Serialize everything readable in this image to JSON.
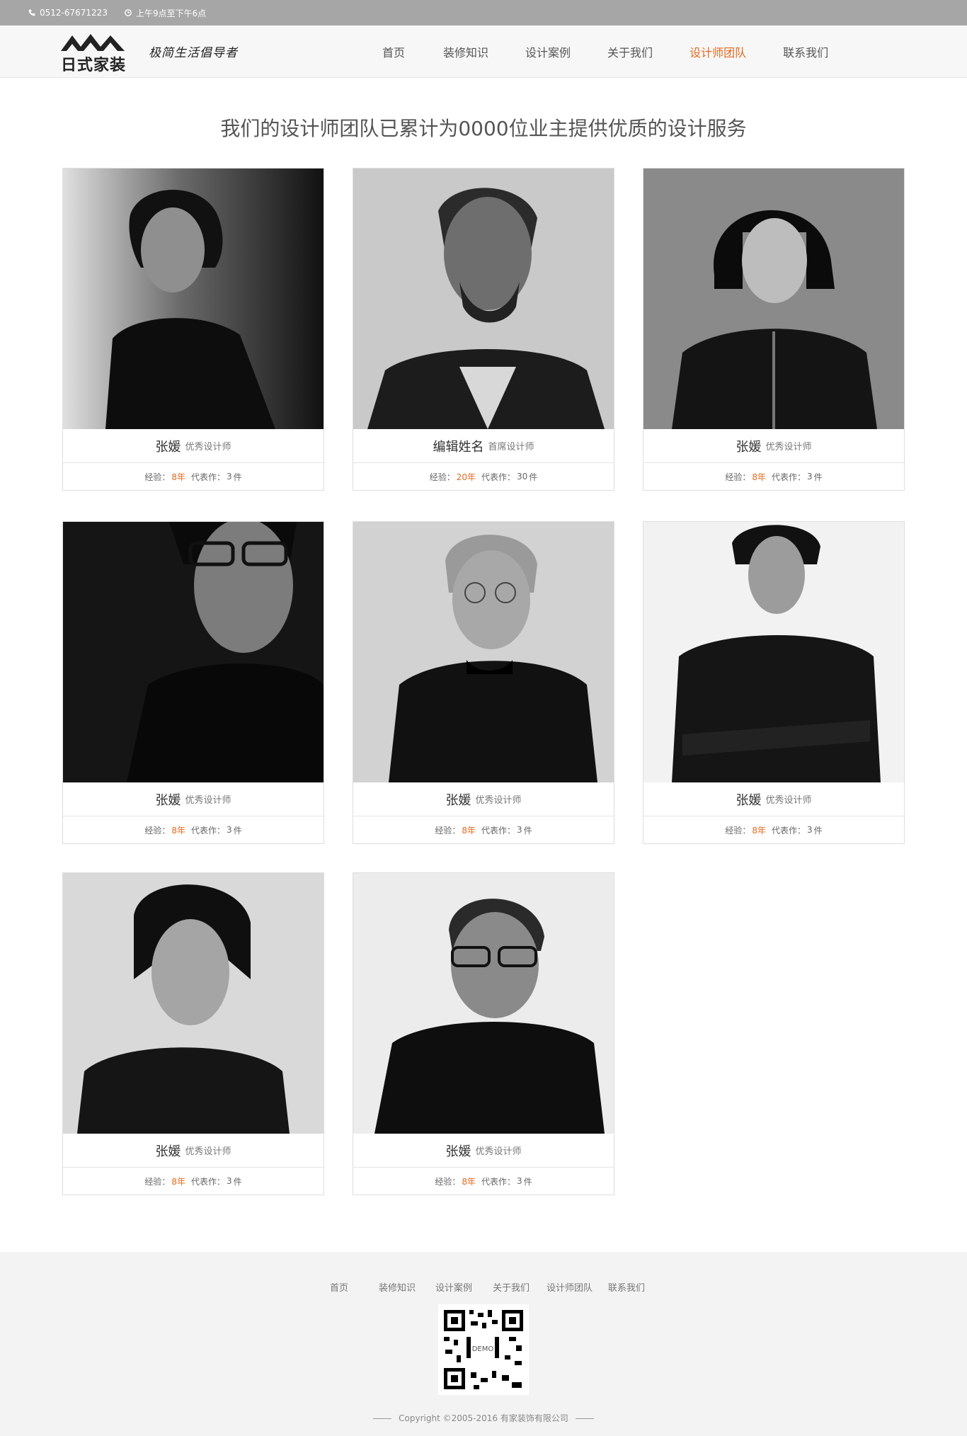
{
  "topbar": {
    "phone": "0512-67671223",
    "hours": "上午9点至下午6点"
  },
  "logo": {
    "brand_text": "日式家装",
    "slogan": "极简生活倡导者"
  },
  "nav": {
    "items": [
      "首页",
      "装修知识",
      "设计案例",
      "关于我们",
      "设计师团队",
      "联系我们"
    ],
    "active": "设计师团队"
  },
  "page": {
    "title": "我们的设计师团队已累计为0000位业主提供优质的设计服务"
  },
  "labels": {
    "experience_prefix": "经验：",
    "works_prefix": "代表作：",
    "works_suffix": "件"
  },
  "designers": [
    {
      "name": "张媛",
      "role": "优秀设计师",
      "experience": "8年",
      "works": "3"
    },
    {
      "name": "编辑姓名",
      "role": "首席设计师",
      "experience": "20年",
      "works": "30"
    },
    {
      "name": "张媛",
      "role": "优秀设计师",
      "experience": "8年",
      "works": "3"
    },
    {
      "name": "张媛",
      "role": "优秀设计师",
      "experience": "8年",
      "works": "3"
    },
    {
      "name": "张媛",
      "role": "优秀设计师",
      "experience": "8年",
      "works": "3"
    },
    {
      "name": "张媛",
      "role": "优秀设计师",
      "experience": "8年",
      "works": "3"
    },
    {
      "name": "张媛",
      "role": "优秀设计师",
      "experience": "8年",
      "works": "3"
    },
    {
      "name": "张媛",
      "role": "优秀设计师",
      "experience": "8年",
      "works": "3"
    }
  ],
  "footer": {
    "nav": [
      "首页",
      "装修知识",
      "设计案例",
      "关于我们",
      "设计师团队",
      "联系我们"
    ],
    "qr_label": "DEMO",
    "copyright": "Copyright ©2005-2016 有家装饰有限公司"
  },
  "colors": {
    "accent": "#e56a1e",
    "topbar": "#a6a6a6",
    "footer_bg": "#f3f3f3"
  }
}
